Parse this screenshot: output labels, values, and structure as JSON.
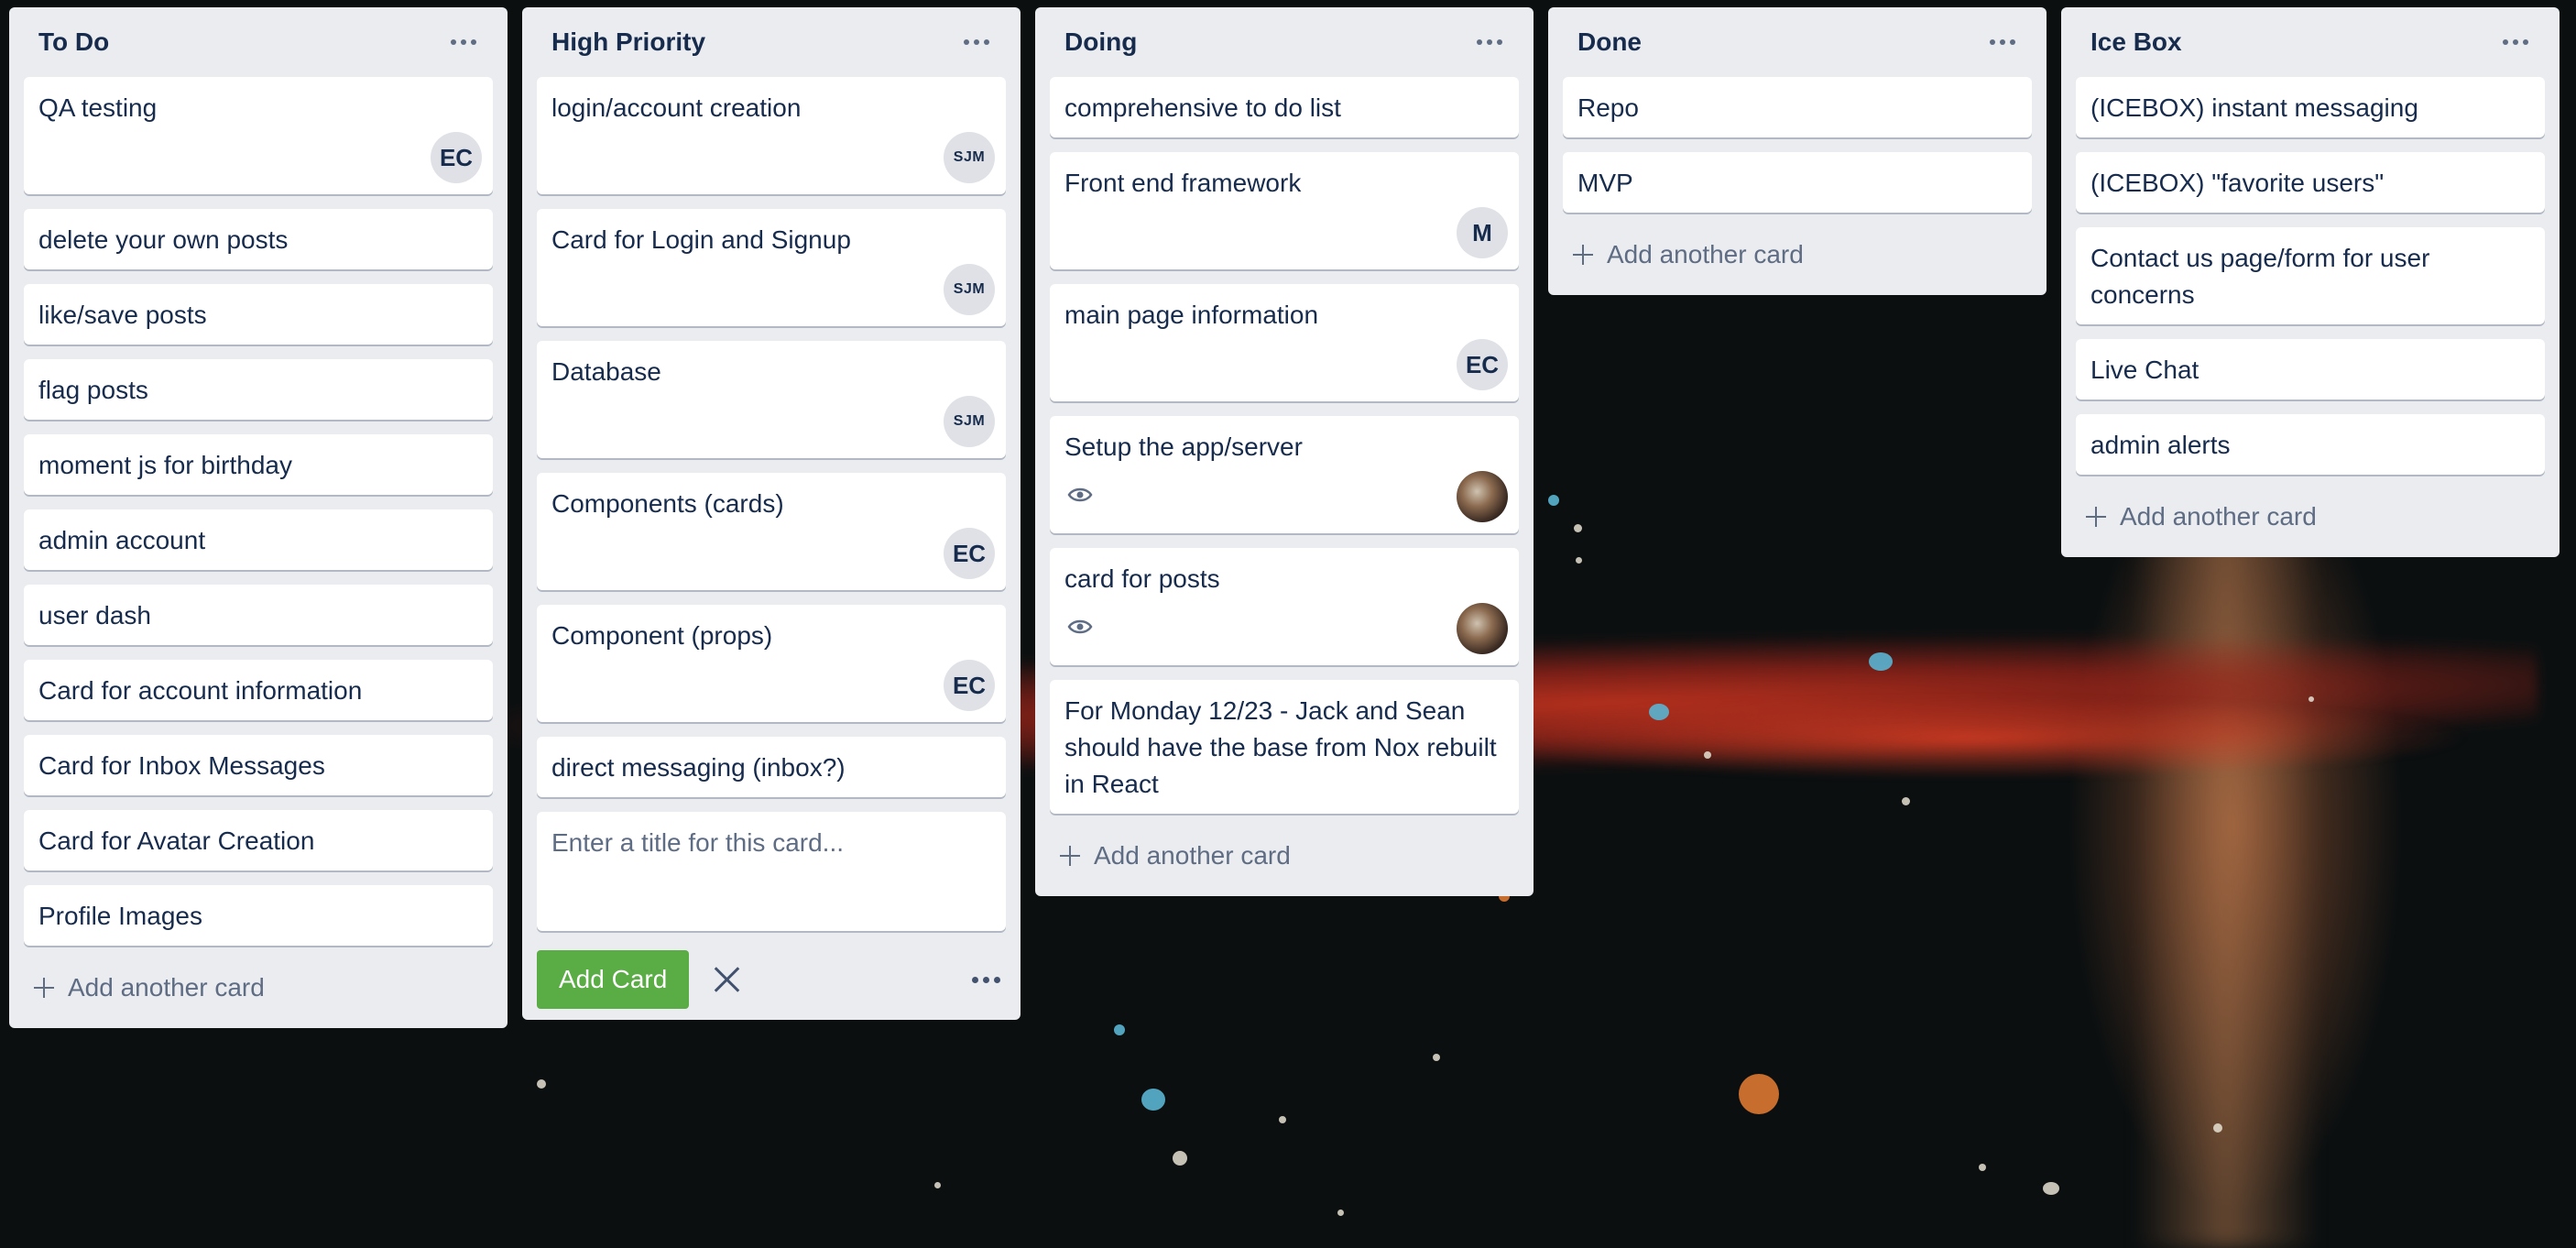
{
  "lists": [
    {
      "title": "To Do",
      "cards": [
        {
          "title": "QA testing",
          "member": "EC"
        },
        {
          "title": "delete your own posts"
        },
        {
          "title": "like/save posts"
        },
        {
          "title": "flag posts"
        },
        {
          "title": "moment js for birthday"
        },
        {
          "title": "admin account"
        },
        {
          "title": "user dash"
        },
        {
          "title": "Card for account information"
        },
        {
          "title": "Card for Inbox Messages"
        },
        {
          "title": "Card for Avatar Creation"
        },
        {
          "title": "Profile Images"
        }
      ],
      "add_label": "Add another card"
    },
    {
      "title": "High Priority",
      "cards": [
        {
          "title": "login/account creation",
          "member": "SJM"
        },
        {
          "title": "Card for Login and Signup",
          "member": "SJM"
        },
        {
          "title": "Database",
          "member": "SJM"
        },
        {
          "title": "Components (cards)",
          "member": "EC"
        },
        {
          "title": "Component (props)",
          "member": "EC"
        },
        {
          "title": "direct messaging (inbox?)"
        }
      ],
      "composer": {
        "placeholder": "Enter a title for this card...",
        "value": "",
        "add_button": "Add Card"
      }
    },
    {
      "title": "Doing",
      "cards": [
        {
          "title": "comprehensive to do list"
        },
        {
          "title": "Front end framework",
          "member": "M"
        },
        {
          "title": "main page information",
          "member": "EC"
        },
        {
          "title": "Setup the app/server",
          "watched": true,
          "member_photo": true
        },
        {
          "title": "card for posts",
          "watched": true,
          "member_photo": true
        },
        {
          "title": "For Monday 12/23 - Jack and Sean should have the base from Nox rebuilt in React"
        }
      ],
      "add_label": "Add another card"
    },
    {
      "title": "Done",
      "cards": [
        {
          "title": "Repo"
        },
        {
          "title": "MVP"
        }
      ],
      "add_label": "Add another card"
    },
    {
      "title": "Ice Box",
      "cards": [
        {
          "title": "(ICEBOX) instant messaging"
        },
        {
          "title": "(ICEBOX) \"favorite users\""
        },
        {
          "title": "Contact us page/form for user concerns"
        },
        {
          "title": "Live Chat"
        },
        {
          "title": "admin alerts"
        }
      ],
      "add_label": "Add another card"
    }
  ]
}
